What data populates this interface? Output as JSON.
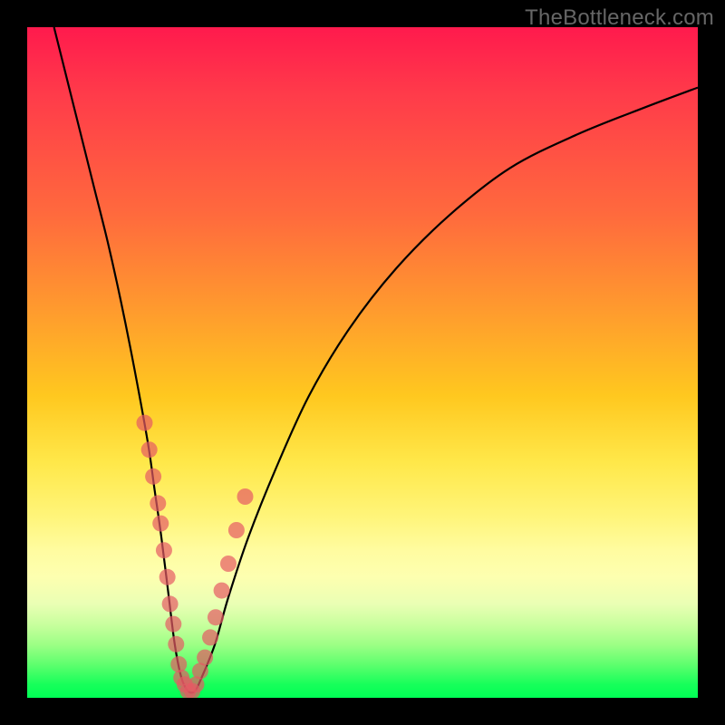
{
  "watermark": "TheBottleneck.com",
  "chart_data": {
    "type": "line",
    "title": "",
    "xlabel": "",
    "ylabel": "",
    "xlim": [
      0,
      100
    ],
    "ylim": [
      0,
      100
    ],
    "grid": false,
    "legend": false,
    "series": [
      {
        "name": "curve",
        "x": [
          4,
          6,
          8,
          10,
          12,
          14,
          16,
          18,
          19,
          20,
          21,
          22,
          23,
          24,
          25,
          26,
          28,
          30,
          33,
          37,
          42,
          48,
          55,
          63,
          72,
          82,
          92,
          100
        ],
        "y": [
          100,
          92,
          84,
          76,
          68,
          59,
          49,
          38,
          31,
          24,
          16,
          8,
          3,
          1,
          1,
          3,
          8,
          15,
          24,
          34,
          45,
          55,
          64,
          72,
          79,
          84,
          88,
          91
        ]
      }
    ],
    "scatter": {
      "name": "dots",
      "x": [
        17.5,
        18.2,
        18.8,
        19.5,
        19.9,
        20.4,
        20.9,
        21.3,
        21.8,
        22.2,
        22.6,
        23.0,
        23.5,
        24.0,
        24.6,
        25.2,
        25.8,
        26.5,
        27.3,
        28.1,
        29.0,
        30.0,
        31.2,
        32.5
      ],
      "y": [
        41,
        37,
        33,
        29,
        26,
        22,
        18,
        14,
        11,
        8,
        5,
        3,
        2,
        1,
        1,
        2,
        4,
        6,
        9,
        12,
        16,
        20,
        25,
        30
      ],
      "r": 9
    }
  }
}
